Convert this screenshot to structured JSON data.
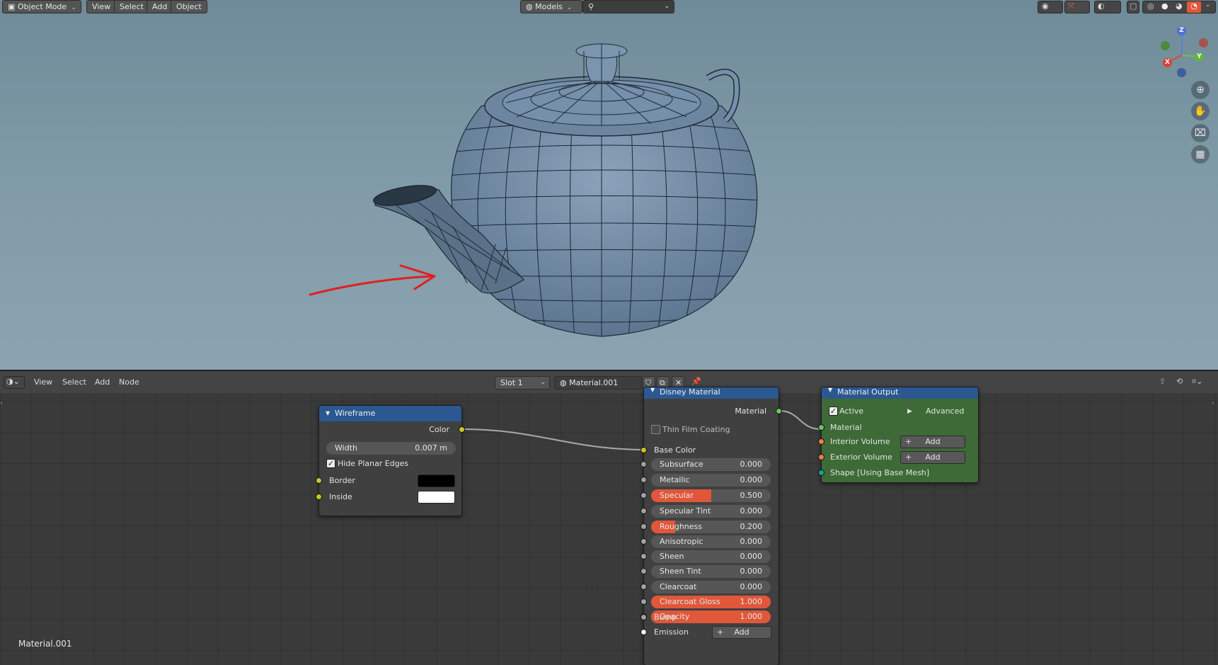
{
  "viewport": {
    "mode": "Object Mode",
    "menu": [
      "View",
      "Select",
      "Add",
      "Object"
    ],
    "collection": "Models",
    "axes": {
      "x": "X",
      "y": "Y",
      "z": "Z"
    },
    "nav_icons": [
      "zoom-icon",
      "pan-hand-icon",
      "camera-icon",
      "grid-icon"
    ],
    "annotation": {
      "color": "#e02020"
    }
  },
  "node_editor": {
    "menu": [
      "View",
      "Select",
      "Add",
      "Node"
    ],
    "slot": "Slot 1",
    "material": "Material.001",
    "footer_label": "Material.001"
  },
  "wireframe_node": {
    "title": "Wireframe",
    "output": "Color",
    "width_label": "Width",
    "width_value": "0.007 m",
    "hide_planar_edges": "Hide Planar Edges",
    "hide_planar_checked": true,
    "border": "Border",
    "inside": "Inside",
    "border_color": "#000000",
    "inside_color": "#ffffff"
  },
  "disney_node": {
    "title": "Disney Material",
    "output": "Material",
    "thin_film": "Thin Film Coating",
    "base_color": "Base Color",
    "params": [
      {
        "label": "Subsurface",
        "value": "0.000",
        "fill": 0.0
      },
      {
        "label": "Metallic",
        "value": "0.000",
        "fill": 0.0
      },
      {
        "label": "Specular",
        "value": "0.500",
        "fill": 0.5
      },
      {
        "label": "Specular Tint",
        "value": "0.000",
        "fill": 0.0
      },
      {
        "label": "Roughness",
        "value": "0.200",
        "fill": 0.2
      },
      {
        "label": "Anisotropic",
        "value": "0.000",
        "fill": 0.0
      },
      {
        "label": "Sheen",
        "value": "0.000",
        "fill": 0.0
      },
      {
        "label": "Sheen Tint",
        "value": "0.000",
        "fill": 0.0
      },
      {
        "label": "Clearcoat",
        "value": "0.000",
        "fill": 0.0
      },
      {
        "label": "Clearcoat Gloss",
        "value": "1.000",
        "fill": 1.0
      },
      {
        "label": "Opacity",
        "value": "1.000",
        "fill": 1.0
      }
    ],
    "bump": "Bump",
    "emission": "Emission",
    "emission_add": "Add"
  },
  "output_node": {
    "title": "Material Output",
    "active": "Active",
    "active_checked": true,
    "advanced": "Advanced",
    "material": "Material",
    "interior": "Interior Volume",
    "exterior": "Exterior Volume",
    "add": "Add",
    "shape": "Shape [Using Base Mesh]"
  },
  "colors": {
    "node_header_blue": "#2b5891",
    "output_body_green": "#3e6a37",
    "slider_fill": "#e0573a"
  }
}
